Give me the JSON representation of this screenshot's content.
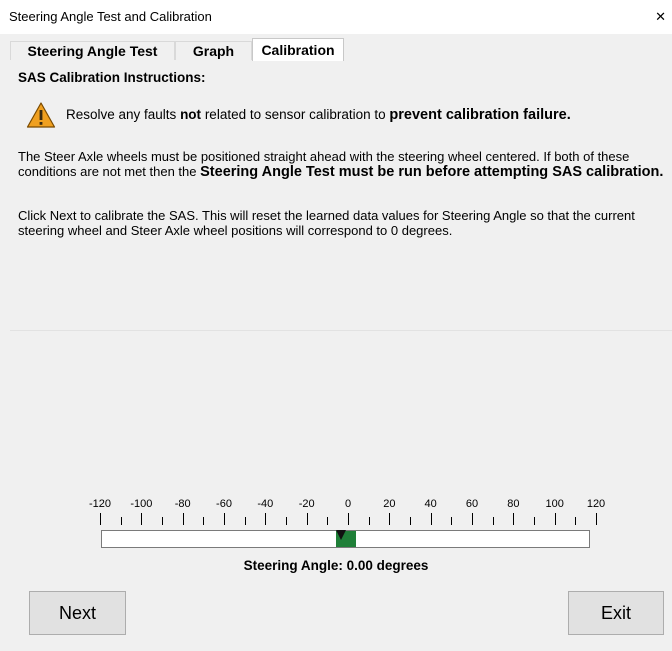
{
  "window": {
    "title": "Steering Angle Test and Calibration",
    "close_glyph": "✕"
  },
  "tabs": [
    {
      "label": "Steering Angle Test",
      "active": false
    },
    {
      "label": "Graph",
      "active": false
    },
    {
      "label": "Calibration",
      "active": true
    }
  ],
  "instructions": {
    "heading": "SAS Calibration Instructions:",
    "warning": {
      "icon": "warning-icon",
      "icon_color": "#f0a020",
      "prefix": "Resolve any faults ",
      "emphasis1": "not",
      "middle": " related to sensor calibration to ",
      "emphasis2": "prevent calibration failure."
    },
    "para1_text": "The Steer Axle wheels must be positioned straight ahead with the steering wheel centered. If both of these conditions are not met then the ",
    "para1_bold": "Steering Angle Test must be run before attempting SAS calibration.",
    "para2_text": "Click Next to calibrate the SAS. This will reset the learned data values for Steering Angle so that the current steering wheel and Steer Axle wheel positions will correspond to 0 degrees."
  },
  "gauge": {
    "tick_labels": [
      "-120",
      "-100",
      "-80",
      "-60",
      "-40",
      "-20",
      "0",
      "20",
      "40",
      "60",
      "80",
      "100",
      "120"
    ],
    "range": [
      -120,
      120
    ],
    "value_degrees": 0.0,
    "indicator_color": "#1f7f38",
    "readout": "Steering Angle: 0.00 degrees"
  },
  "buttons": {
    "next_label": "Next",
    "exit_label": "Exit"
  }
}
